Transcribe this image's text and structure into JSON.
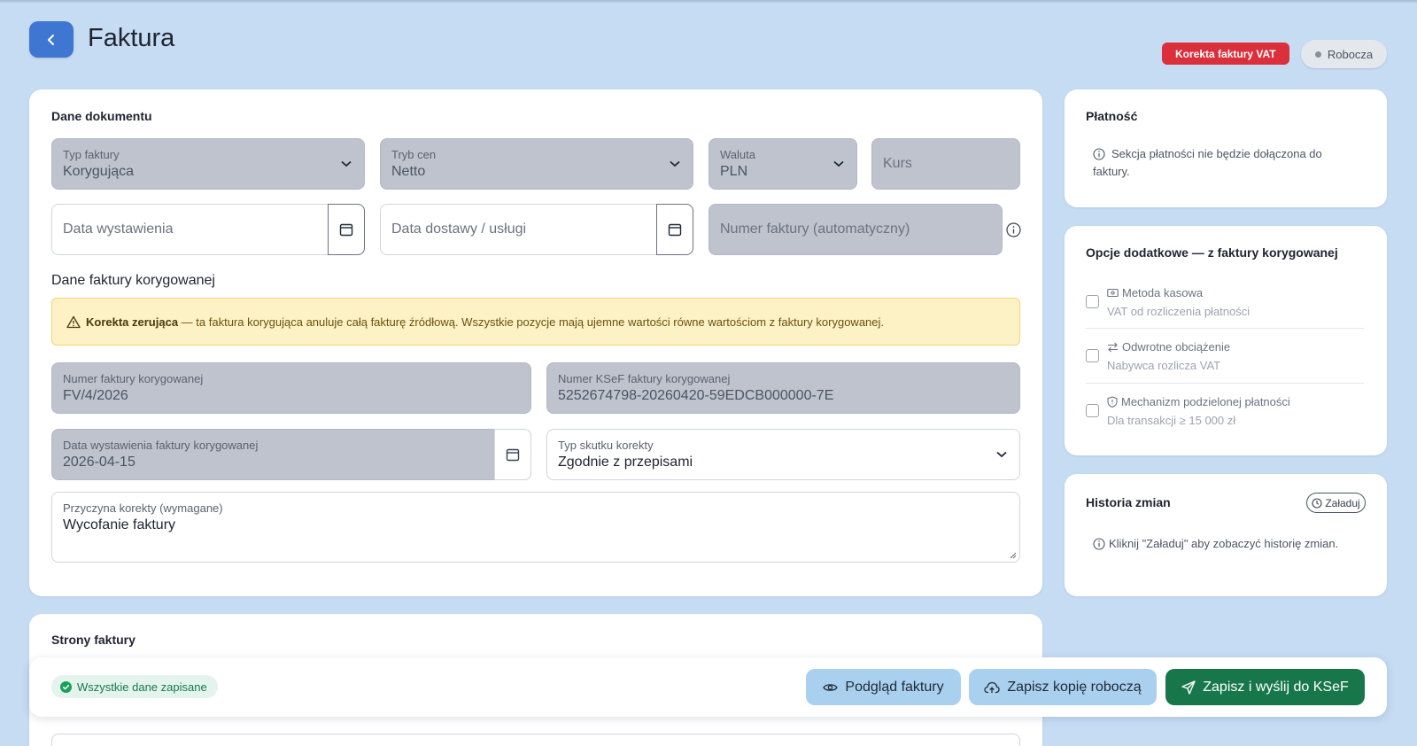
{
  "header": {
    "title": "Faktura",
    "badge_correction": "Korekta faktury VAT",
    "badge_status": "Robocza"
  },
  "document": {
    "section_title": "Dane dokumentu",
    "invoice_type": {
      "label": "Typ faktury",
      "value": "Korygująca"
    },
    "price_mode": {
      "label": "Tryb cen",
      "value": "Netto"
    },
    "currency": {
      "label": "Waluta",
      "value": "PLN"
    },
    "rate": {
      "placeholder": "Kurs"
    },
    "issue_date": {
      "placeholder": "Data wystawienia"
    },
    "delivery_date": {
      "placeholder": "Data dostawy / usługi"
    },
    "invoice_number": {
      "placeholder": "Numer faktury (automatyczny)"
    }
  },
  "corrected": {
    "section_title": "Dane faktury korygowanej",
    "warning_bold": "Korekta zerująca",
    "warning_text": " — ta faktura korygująca anuluje całą fakturę źródłową. Wszystkie pozycje mają ujemne wartości równe wartościom z faktury korygowanej.",
    "number": {
      "label": "Numer faktury korygowanej",
      "value": "FV/4/2026"
    },
    "ksef_number": {
      "label": "Numer KSeF faktury korygowanej",
      "value": "5252674798-20260420-59EDCB000000-7E"
    },
    "issue_date": {
      "label": "Data wystawienia faktury korygowanej",
      "value": "2026-04-15"
    },
    "effect_type": {
      "label": "Typ skutku korekty",
      "value": "Zgodnie z przepisami"
    },
    "reason": {
      "label": "Przyczyna korekty (wymagane)",
      "value": "Wycofanie faktury"
    }
  },
  "parties": {
    "section_title": "Strony faktury"
  },
  "payment": {
    "title": "Płatność",
    "info": "Sekcja płatności nie będzie dołączona do faktury."
  },
  "options": {
    "title": "Opcje dodatkowe — z faktury korygowanej",
    "items": [
      {
        "label": "Metoda kasowa",
        "desc": "VAT od rozliczenia płatności"
      },
      {
        "label": "Odwrotne obciążenie",
        "desc": "Nabywca rozlicza VAT"
      },
      {
        "label": "Mechanizm podzielonej płatności",
        "desc": "Dla transakcji ≥ 15 000 zł"
      }
    ]
  },
  "history": {
    "title": "Historia zmian",
    "load_label": "Załaduj",
    "info": "Kliknij \"Załaduj\" aby zobaczyć historię zmian."
  },
  "footer": {
    "saved_status": "Wszystkie dane zapisane",
    "preview_label": "Podgląd faktury",
    "draft_label": "Zapisz kopię roboczą",
    "send_label": "Zapisz i wyślij do KSeF"
  },
  "colors": {
    "background": "#c6dcf3",
    "accent_blue": "#3f76d1",
    "badge_red": "#dc2f3c",
    "send_green": "#17774a",
    "light_button": "#a9d0ee"
  }
}
